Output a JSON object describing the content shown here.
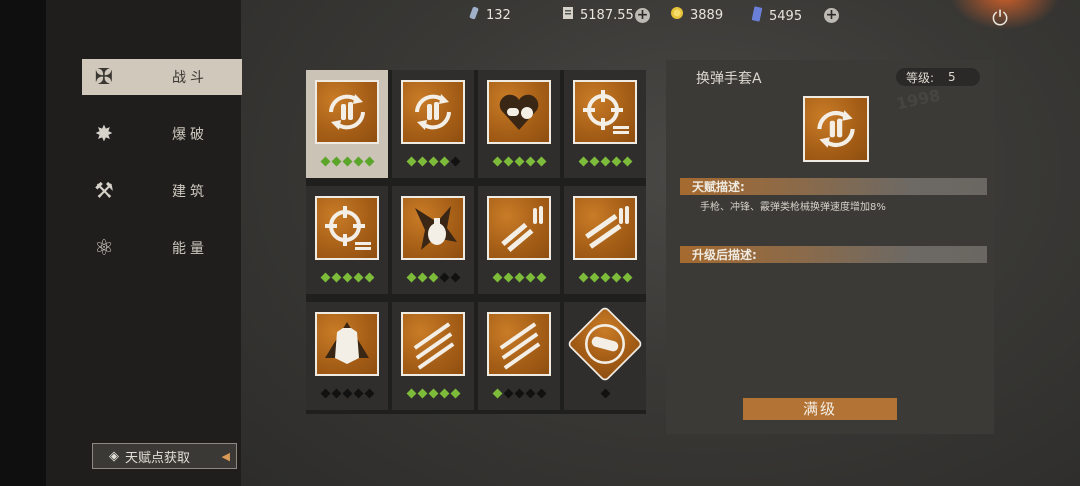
{
  "resources": [
    {
      "icon": "gem-icon",
      "value": "132"
    },
    {
      "icon": "cash-icon",
      "value": "5187.55"
    },
    {
      "icon": "coin-icon",
      "value": "3889"
    },
    {
      "icon": "card-icon",
      "value": "5495"
    }
  ],
  "sidebar": {
    "items": [
      {
        "label": "战斗",
        "icon": "combat-icon",
        "active": true
      },
      {
        "label": "爆破",
        "icon": "explosion-icon",
        "active": false
      },
      {
        "label": "建筑",
        "icon": "build-icon",
        "active": false
      },
      {
        "label": "能量",
        "icon": "energy-icon",
        "active": false
      }
    ],
    "talent_source": "天赋点获取"
  },
  "talents": [
    {
      "icon": "reload-ammo-icon",
      "level": 5,
      "max": 5,
      "selected": true
    },
    {
      "icon": "reload-ammo-icon",
      "level": 4,
      "max": 5
    },
    {
      "icon": "heart-pill-icon",
      "level": 5,
      "max": 5
    },
    {
      "icon": "crosshair-ammo-icon",
      "level": 5,
      "max": 5
    },
    {
      "icon": "crosshair-ammo-icon",
      "level": 5,
      "max": 5
    },
    {
      "icon": "grenade-icon",
      "level": 3,
      "max": 5
    },
    {
      "icon": "guns-ammo-icon",
      "level": 5,
      "max": 5
    },
    {
      "icon": "rifles-ammo-icon",
      "level": 5,
      "max": 5
    },
    {
      "icon": "body-armor-icon",
      "level": 0,
      "max": 5
    },
    {
      "icon": "rifles-icon",
      "level": 5,
      "max": 5
    },
    {
      "icon": "rifles-icon",
      "level": 1,
      "max": 5
    },
    {
      "icon": "rocket-icon",
      "level": 0,
      "max": 1
    }
  ],
  "detail": {
    "title": "换弹手套A",
    "level_label": "等级:",
    "level_value": "5",
    "talent_desc_label": "天赋描述:",
    "talent_desc": "手枪、冲锋、霰弹类枪械换弹速度增加8%",
    "upgrade_desc_label": "升级后描述:",
    "max_button": "满级"
  },
  "colors": {
    "accent_orange": "#b27334",
    "pip_on": "#7dbb3a",
    "pip_off": "#111111"
  }
}
